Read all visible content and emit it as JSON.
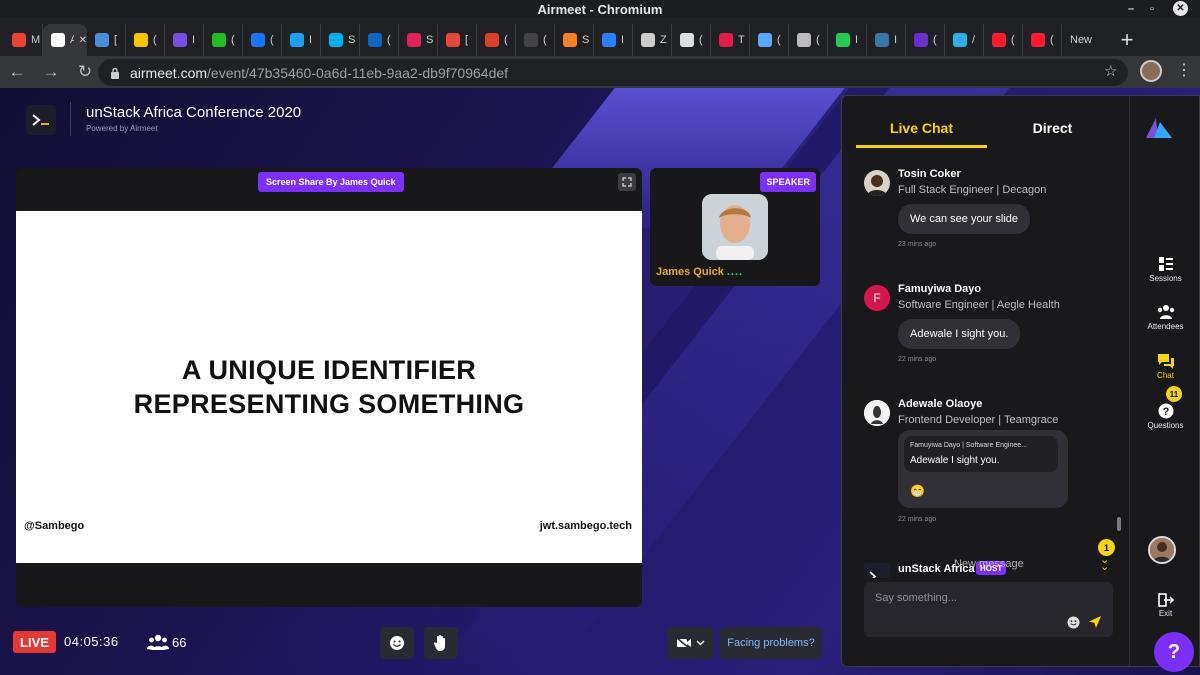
{
  "window": {
    "title": "Airmeet - Chromium"
  },
  "tabs": [
    {
      "label": "M [",
      "icon": "gmail-icon",
      "color": "#ea4335"
    },
    {
      "label": "A",
      "icon": "airmeet-icon",
      "color": "#ffffff",
      "active": true
    },
    {
      "label": "[",
      "icon": "monitor-icon",
      "color": "#4a90d9"
    },
    {
      "label": "(",
      "icon": "keep-icon",
      "color": "#f9c400"
    },
    {
      "label": "I",
      "icon": "c-icon",
      "color": "#7b4fe0"
    },
    {
      "label": "(",
      "icon": "phone-icon",
      "color": "#20c020"
    },
    {
      "label": "(",
      "icon": "facebook-icon",
      "color": "#1877f2"
    },
    {
      "label": "I",
      "icon": "twitter-icon",
      "color": "#1da1f2"
    },
    {
      "label": "S",
      "icon": "skype-icon",
      "color": "#00aff0"
    },
    {
      "label": "(",
      "icon": "linkedin-icon",
      "color": "#0a66c2"
    },
    {
      "label": "S",
      "icon": "slack-icon",
      "color": "#e01e5a"
    },
    {
      "label": "[",
      "icon": "calendar-icon",
      "color": "#e8453c"
    },
    {
      "label": "(",
      "icon": "ask-icon",
      "color": "#d9422b"
    },
    {
      "label": "(",
      "icon": "github-icon",
      "color": "#444444"
    },
    {
      "label": "S",
      "icon": "stackoverflow-icon",
      "color": "#f48024"
    },
    {
      "label": "I",
      "icon": "k-icon",
      "color": "#2a7fff"
    },
    {
      "label": "Z",
      "icon": "z-icon",
      "color": "#cccccc"
    },
    {
      "label": "(",
      "icon": "globe-icon",
      "color": "#dddddd"
    },
    {
      "label": "T",
      "icon": "play-icon",
      "color": "#e5194a"
    },
    {
      "label": "(",
      "icon": "infinity-icon",
      "color": "#5aa9ff"
    },
    {
      "label": "(",
      "icon": "triangle-icon",
      "color": "#bbbbbb"
    },
    {
      "label": "I",
      "icon": "r-icon",
      "color": "#22cc55"
    },
    {
      "label": "I",
      "icon": "python-icon",
      "color": "#3b77a8"
    },
    {
      "label": "(",
      "icon": "purple-icon",
      "color": "#6a2fd0"
    },
    {
      "label": "/",
      "icon": "dot-icon",
      "color": "#2bb0e8"
    },
    {
      "label": "(",
      "icon": "opera-icon",
      "color": "#ff1b2d"
    },
    {
      "label": "(",
      "icon": "opera-icon",
      "color": "#ff1b2d"
    },
    {
      "label": "New",
      "icon": "",
      "color": ""
    }
  ],
  "address": {
    "host": "airmeet.com",
    "path": "/event/47b35460-0a6d-11eb-9aa2-db9f70964def"
  },
  "event": {
    "title": "unStack Africa Conference 2020",
    "powered": "Powered by Airmeet"
  },
  "stage": {
    "share_label": "Screen Share By James Quick",
    "slide_heading_1": "A UNIQUE IDENTIFIER",
    "slide_heading_2": "REPRESENTING SOMETHING",
    "slide_left": "@Sambego",
    "slide_right": "jwt.sambego.tech"
  },
  "speaker": {
    "tag": "SPEAKER",
    "name": "James Quick",
    "level": "...."
  },
  "bottombar": {
    "live": "LIVE",
    "timer": "04:05:36",
    "attendees": "66",
    "facing": "Facing problems?"
  },
  "chat": {
    "tab_live": "Live Chat",
    "tab_direct": "Direct",
    "messages": [
      {
        "name": "Tosin Coker",
        "role": "Full Stack Engineer | Decagon",
        "text": "We can see your slide",
        "time": "23 mins ago"
      },
      {
        "name": "Famuyiwa Dayo",
        "initial": "F",
        "role": "Software Engineer | Aegle Health",
        "text": "Adewale I sight you.",
        "time": "22 mins ago"
      },
      {
        "name": "Adewale Olaoye",
        "role": "Frontend Developer | Teamgrace",
        "quote_meta": "Famuyiwa Dayo | Software Enginee...",
        "quote_text": "Adewale I sight you.",
        "reaction": "😁",
        "time": "22 mins ago"
      },
      {
        "name": "unStack Africa",
        "badge": "HOST",
        "overlay": "New message"
      }
    ],
    "unread": "1",
    "placeholder": "Say something..."
  },
  "sidebar": {
    "sessions": "Sessions",
    "attendees": "Attendees",
    "chat": "Chat",
    "questions": "Questions",
    "questions_count": "11",
    "exit": "Exit"
  },
  "help": "?",
  "colors": {
    "accent": "#f5d410",
    "brand_purple": "#7b2ff7",
    "live_red": "#e53935"
  }
}
